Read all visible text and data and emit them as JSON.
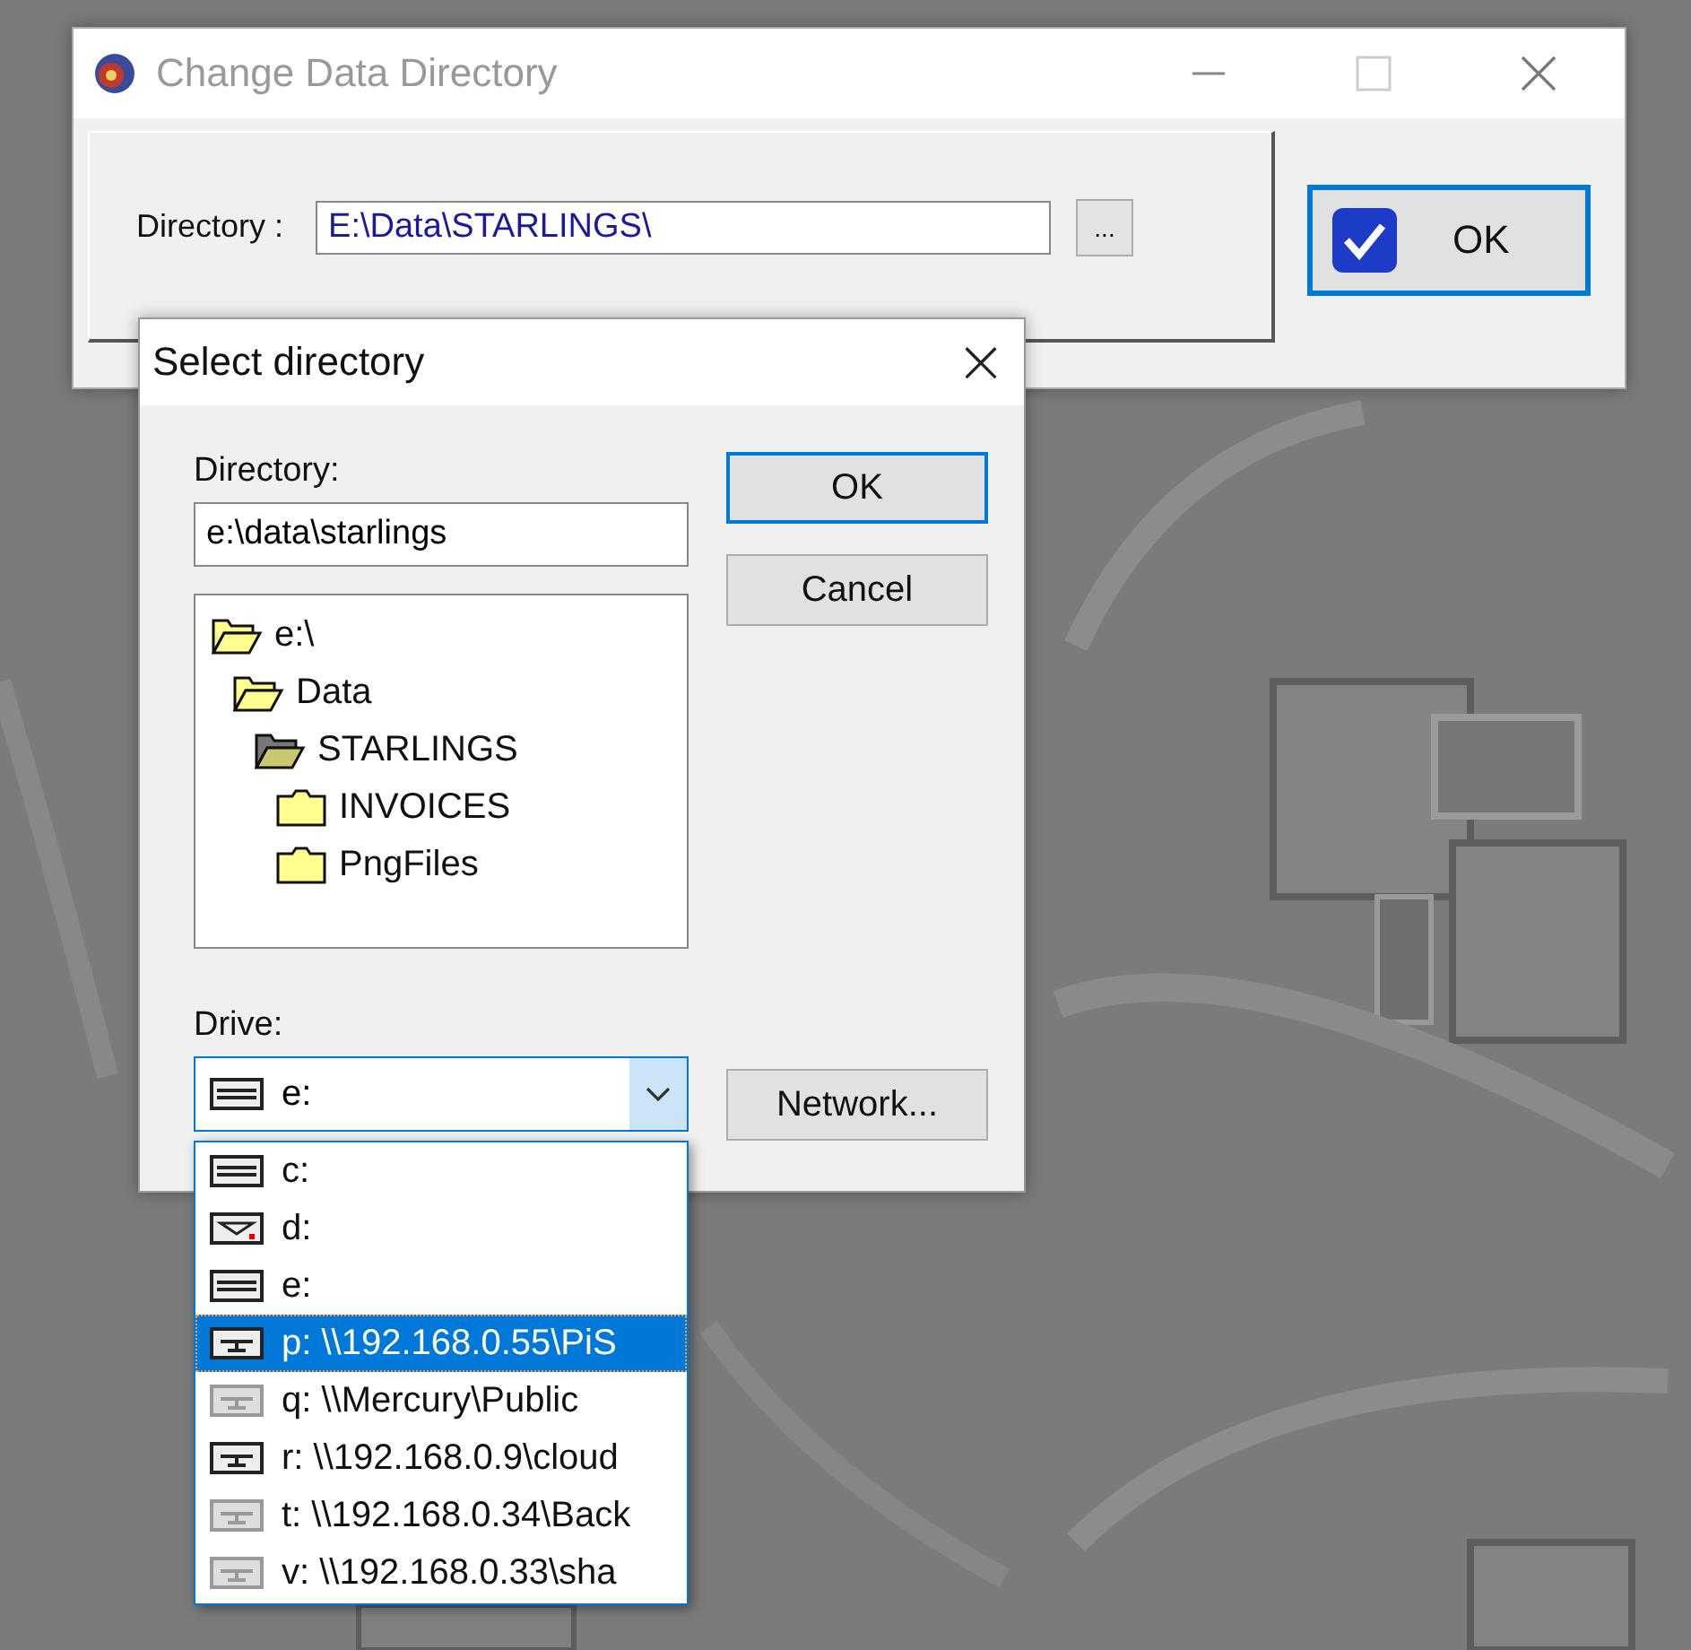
{
  "main_window": {
    "title": "Change Data Directory",
    "directory_label": "Directory :",
    "directory_value": "E:\\Data\\STARLINGS\\",
    "browse_button": "...",
    "ok_button": "OK"
  },
  "dialog": {
    "title": "Select directory",
    "close": "×",
    "directory_label": "Directory:",
    "directory_value": "e:\\data\\starlings",
    "ok_button": "OK",
    "cancel_button": "Cancel",
    "tree": [
      {
        "label": "e:\\",
        "expanded": true,
        "selected": false,
        "children": [
          {
            "label": "Data",
            "expanded": true,
            "selected": false,
            "children": [
              {
                "label": "STARLINGS",
                "expanded": true,
                "selected": true,
                "children": [
                  {
                    "label": "INVOICES",
                    "expanded": false,
                    "selected": false
                  },
                  {
                    "label": "PngFiles",
                    "expanded": false,
                    "selected": false
                  }
                ]
              }
            ]
          }
        ]
      }
    ],
    "drive_label": "Drive:",
    "drive_value": {
      "label": "e:",
      "kind": "fixed"
    },
    "network_button": "Network...",
    "drive_list": [
      {
        "label": "c:",
        "kind": "fixed",
        "selected": false
      },
      {
        "label": "d:",
        "kind": "cdrom",
        "selected": false
      },
      {
        "label": "e:",
        "kind": "fixed",
        "selected": false
      },
      {
        "label": "p: \\\\192.168.0.55\\PiS",
        "kind": "network",
        "selected": true
      },
      {
        "label": "q: \\\\Mercury\\Public",
        "kind": "offline",
        "selected": false
      },
      {
        "label": "r: \\\\192.168.0.9\\cloud",
        "kind": "network",
        "selected": false
      },
      {
        "label": "t: \\\\192.168.0.34\\Back",
        "kind": "offline",
        "selected": false
      },
      {
        "label": "v: \\\\192.168.0.33\\sha",
        "kind": "offline",
        "selected": false
      }
    ]
  }
}
